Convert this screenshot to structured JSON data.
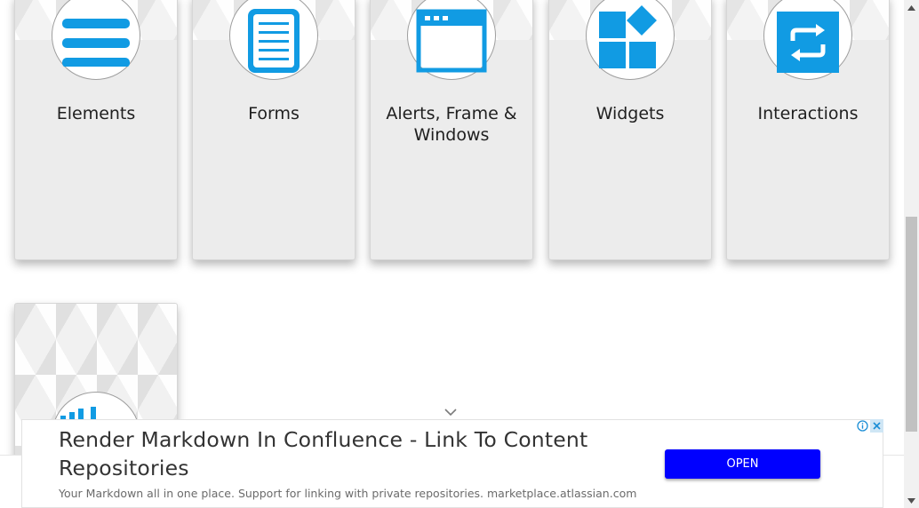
{
  "categories": [
    {
      "label": "Elements",
      "icon": "hamburger-icon"
    },
    {
      "label": "Forms",
      "icon": "document-icon"
    },
    {
      "label": "Alerts, Frame & Windows",
      "icon": "window-icon"
    },
    {
      "label": "Widgets",
      "icon": "widgets-icon"
    },
    {
      "label": "Interactions",
      "icon": "repeat-icon"
    }
  ],
  "ad": {
    "headline": "Render Markdown In Confluence - Link To Content Repositories",
    "description": "Your Markdown all in one place. Support for linking with private repositories. marketplace.atlassian.com",
    "button": "OPEN"
  },
  "colors": {
    "accent": "#119be3",
    "card_bg": "#ececec",
    "ad_button": "#0000ff"
  }
}
